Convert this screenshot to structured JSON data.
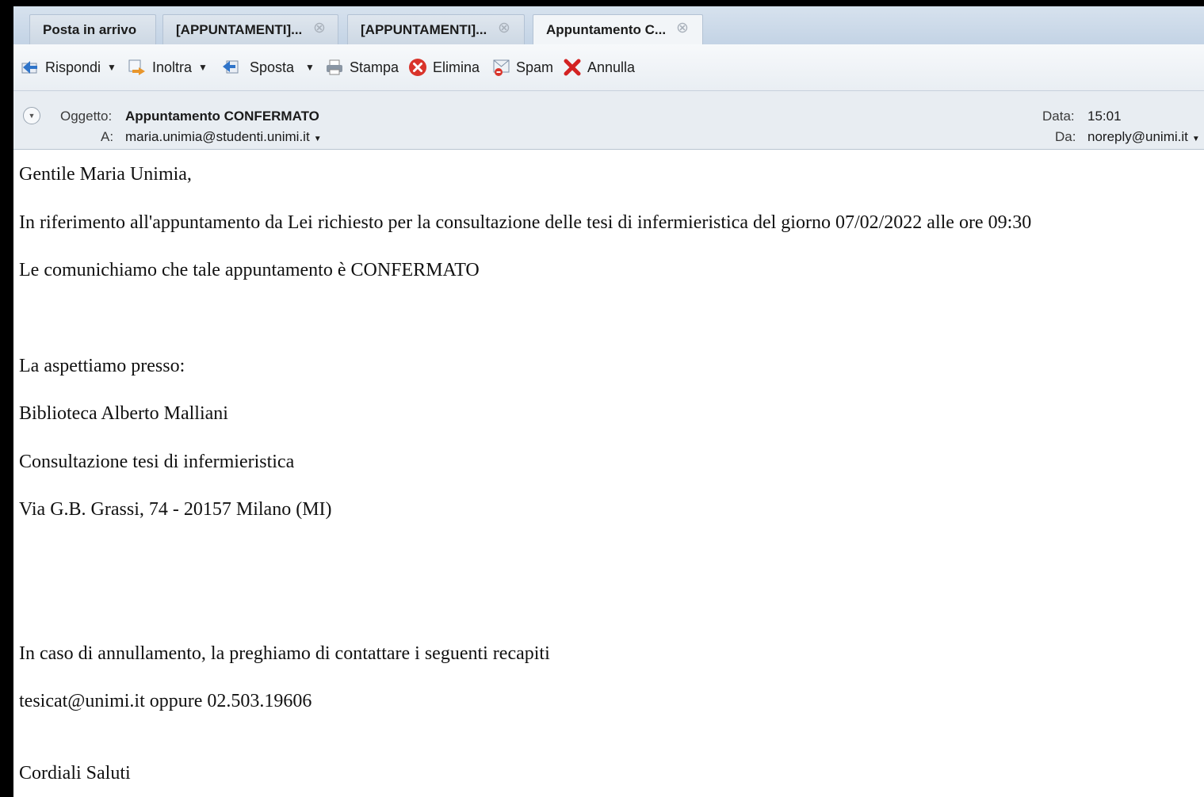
{
  "tabs": [
    {
      "label": "Posta in arrivo",
      "closable": false
    },
    {
      "label": "[APPUNTAMENTI]...",
      "closable": true
    },
    {
      "label": "[APPUNTAMENTI]...",
      "closable": true
    },
    {
      "label": "Appuntamento C...",
      "closable": true,
      "active": true
    }
  ],
  "toolbar": {
    "reply": "Rispondi",
    "forward": "Inoltra",
    "move": "Sposta",
    "print": "Stampa",
    "delete": "Elimina",
    "spam": "Spam",
    "undo": "Annulla"
  },
  "message": {
    "subject_label": "Oggetto:",
    "subject": "Appuntamento CONFERMATO",
    "to_label": "A:",
    "to": "maria.unimia@studenti.unimi.it",
    "date_label": "Data:",
    "date": "15:01",
    "from_label": "Da:",
    "from": "noreply@unimi.it"
  },
  "body": {
    "greeting": "Gentile Maria Unimia,",
    "line1": "In riferimento all'appuntamento da Lei richiesto per la consultazione delle tesi di infermieristica del giorno 07/02/2022 alle ore 09:30",
    "line2": "Le comunichiamo che tale appuntamento è CONFERMATO",
    "line3": "La aspettiamo presso:",
    "line4": "Biblioteca Alberto Malliani",
    "line5": "Consultazione tesi di infermieristica",
    "line6": "Via G.B. Grassi, 74 - 20157 Milano (MI)",
    "line7": "In caso di annullamento, la preghiamo di contattare i seguenti recapiti",
    "line8": "tesicat@unimi.it oppure 02.503.19606",
    "closing": "Cordiali Saluti"
  },
  "colors": {
    "tab_bar": "#c3d3e5",
    "toolbar": "#eef2f6",
    "header": "#e8edf2",
    "delete_icon": "#d9342b",
    "cancel_icon": "#d32222",
    "arrow_icon": "#2f74c9"
  }
}
